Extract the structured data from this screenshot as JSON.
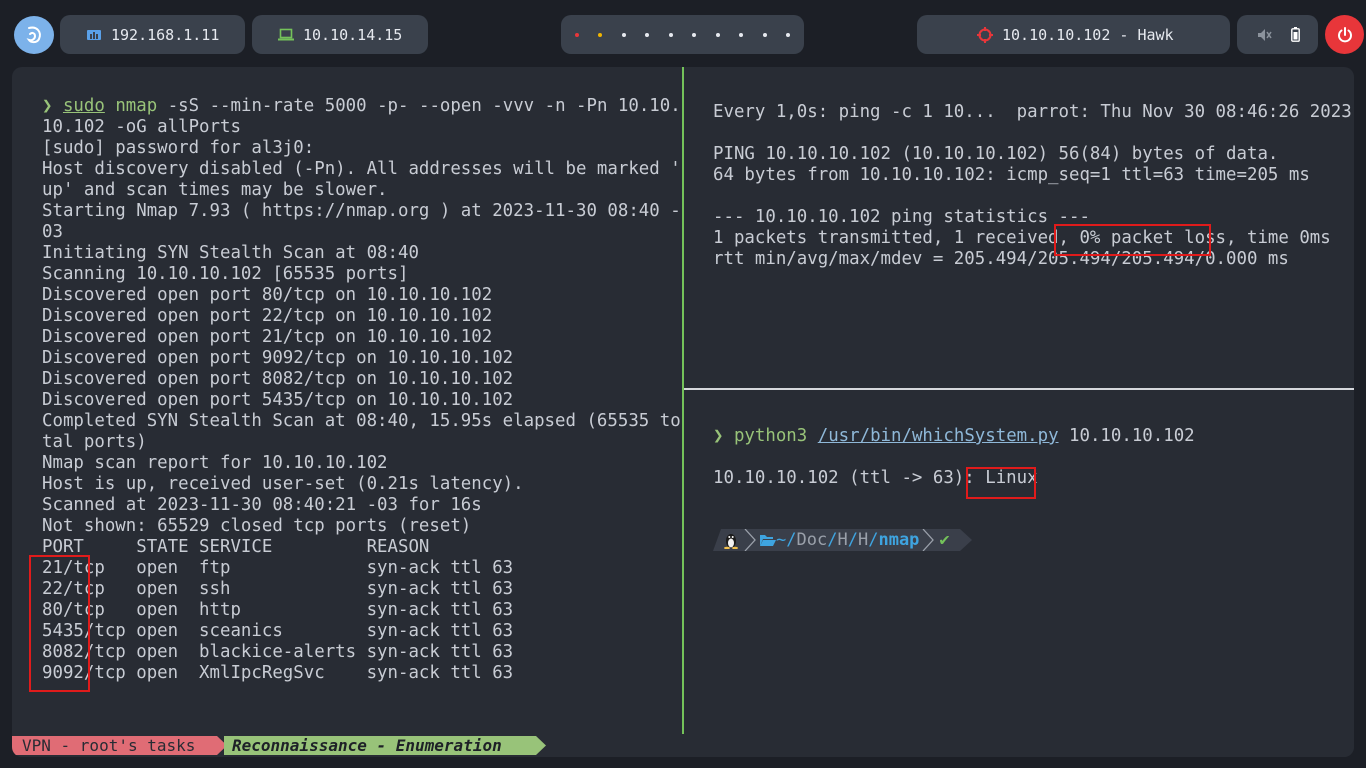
{
  "topbar": {
    "ip_local": "192.168.1.11",
    "ip_vpn": "10.10.14.15",
    "target": "10.10.10.102 - Hawk",
    "colors": {
      "pill": "#3a414c",
      "logo": "#7cb2ea",
      "power": "#e8363a",
      "accent_red": "#e8363a",
      "accent_yellow": "#f0b400"
    }
  },
  "left_pane": {
    "prompt_sudo": "sudo",
    "prompt_cmd": "nmap",
    "prompt_args": " -sS --min-rate 5000 -p- --open -vvv -n -Pn 10.10.",
    "lines": [
      "10.102 -oG allPorts",
      "[sudo] password for al3j0:",
      "Host discovery disabled (-Pn). All addresses will be marked '",
      "up' and scan times may be slower.",
      "Starting Nmap 7.93 ( https://nmap.org ) at 2023-11-30 08:40 -",
      "03",
      "Initiating SYN Stealth Scan at 08:40",
      "Scanning 10.10.10.102 [65535 ports]",
      "Discovered open port 80/tcp on 10.10.10.102",
      "Discovered open port 22/tcp on 10.10.10.102",
      "Discovered open port 21/tcp on 10.10.10.102",
      "Discovered open port 9092/tcp on 10.10.10.102",
      "Discovered open port 8082/tcp on 10.10.10.102",
      "Discovered open port 5435/tcp on 10.10.10.102",
      "Completed SYN Stealth Scan at 08:40, 15.95s elapsed (65535 to",
      "tal ports)",
      "Nmap scan report for 10.10.10.102",
      "Host is up, received user-set (0.21s latency).",
      "Scanned at 2023-11-30 08:40:21 -03 for 16s",
      "Not shown: 65529 closed tcp ports (reset)",
      "PORT     STATE SERVICE         REASON",
      "21/tcp   open  ftp             syn-ack ttl 63",
      "22/tcp   open  ssh             syn-ack ttl 63",
      "80/tcp   open  http            syn-ack ttl 63",
      "5435/tcp open  sceanics        syn-ack ttl 63",
      "8082/tcp open  blackice-alerts syn-ack ttl 63",
      "9092/tcp open  XmlIpcRegSvc    syn-ack ttl 63"
    ]
  },
  "right_top": {
    "lines": [
      "Every 1,0s: ping -c 1 10...  parrot: Thu Nov 30 08:46:26 2023",
      "",
      "PING 10.10.10.102 (10.10.10.102) 56(84) bytes of data.",
      "64 bytes from 10.10.10.102: icmp_seq=1 ttl=63 time=205 ms",
      "",
      "--- 10.10.10.102 ping statistics ---",
      "1 packets transmitted, 1 received, 0% packet loss, time 0ms",
      "rtt min/avg/max/mdev = 205.494/205.494/205.494/0.000 ms"
    ]
  },
  "right_bottom": {
    "cmd": "python3",
    "script": "/usr/bin/whichSystem.py",
    "arg": " 10.10.10.102",
    "result_prefix": "10.10.10.102 (ttl -> 63): ",
    "result_os": "Linux",
    "prompt_path_home": "~",
    "prompt_path_1": "Doc",
    "prompt_path_2": "H",
    "prompt_path_3": "H",
    "prompt_path_current": "nmap",
    "prompt_ok": "✔"
  },
  "statusbar": {
    "session": "VPN - root's tasks",
    "window": "Reconnaissance - Enumeration"
  }
}
